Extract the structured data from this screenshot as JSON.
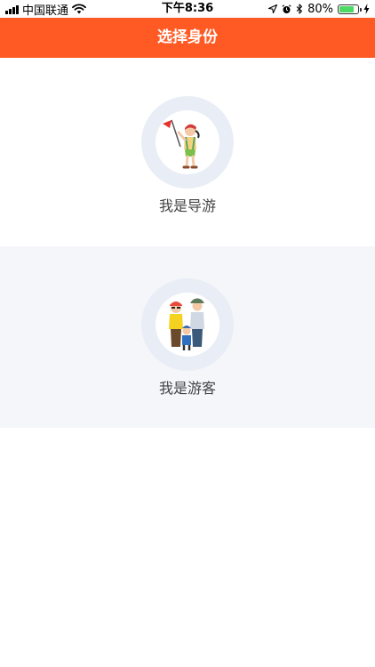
{
  "status": {
    "carrier": "中国联通",
    "time": "下午8:36",
    "battery": "80%",
    "battery_level": 0.8
  },
  "nav": {
    "title": "选择身份"
  },
  "options": [
    {
      "label": "我是导游",
      "icon": "guide-illustration"
    },
    {
      "label": "我是游客",
      "icon": "tourist-family-illustration"
    }
  ],
  "colors": {
    "accent": "#ff5a24",
    "ring": "#e9eef6",
    "section_alt_bg": "#f5f6fa",
    "battery": "#4cd964"
  }
}
